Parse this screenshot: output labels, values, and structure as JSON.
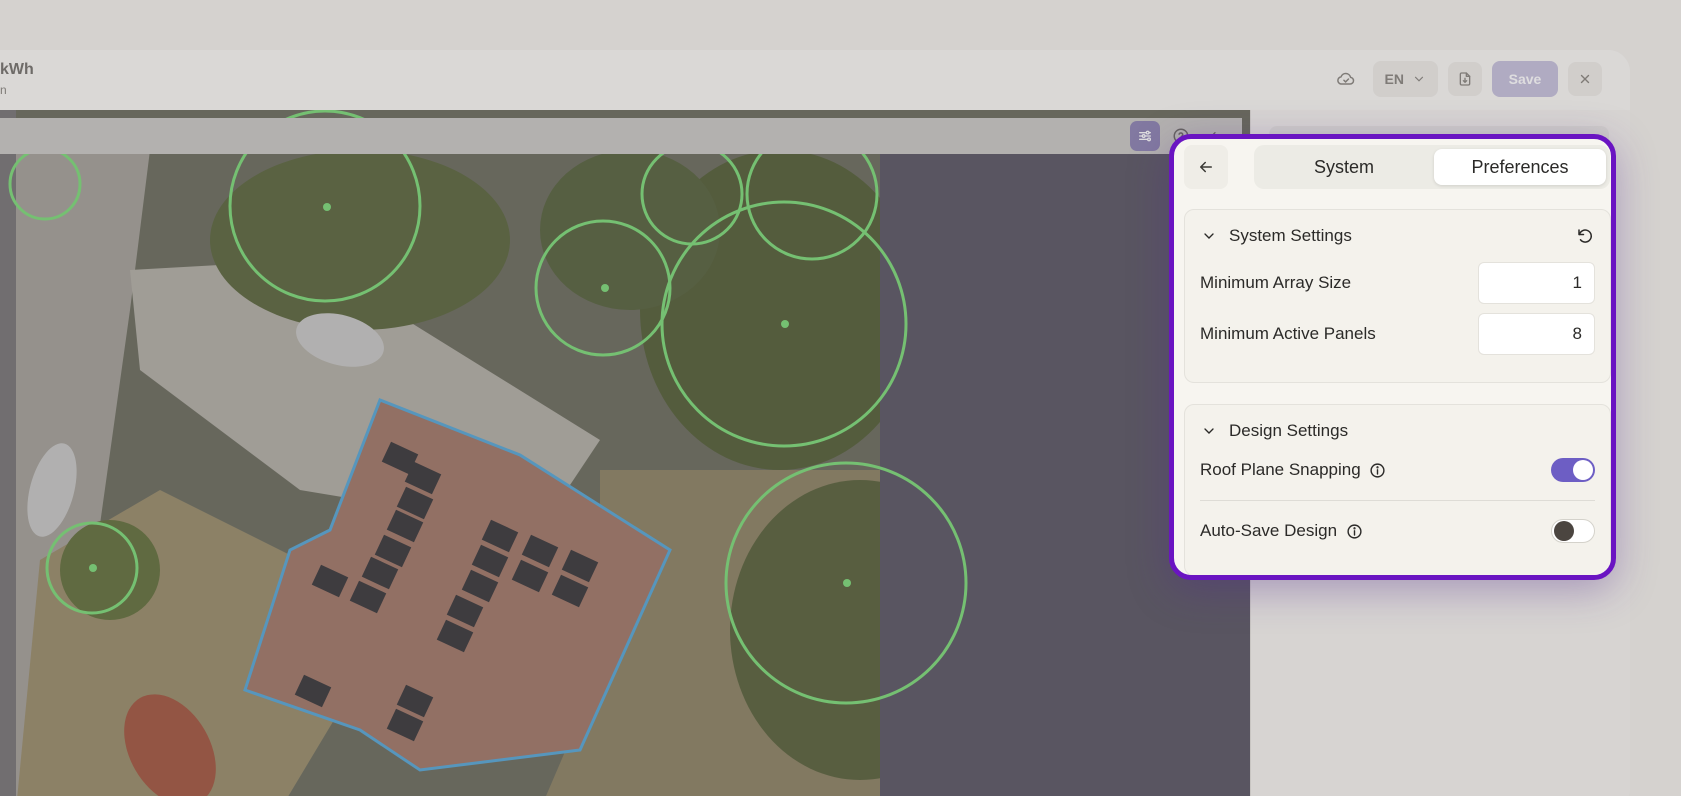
{
  "header": {
    "energy_text": "kWh",
    "sub_text": "n",
    "language": "EN",
    "save_label": "Save"
  },
  "colors": {
    "accent": "#6a14c2",
    "toggle_on": "#6d5ec4",
    "tree_ring": "#7fdc7a",
    "roof_outline": "#5aa9d6"
  },
  "popover": {
    "tabs": [
      {
        "label": "System",
        "active": false
      },
      {
        "label": "Preferences",
        "active": true
      }
    ],
    "system_settings": {
      "title": "System Settings",
      "fields": [
        {
          "label": "Minimum Array Size",
          "value": "1"
        },
        {
          "label": "Minimum Active Panels",
          "value": "8"
        }
      ]
    },
    "design_settings": {
      "title": "Design Settings",
      "toggles": [
        {
          "label": "Roof Plane Snapping",
          "on": true
        },
        {
          "label": "Auto-Save Design",
          "on": false
        }
      ]
    }
  },
  "icons": [
    "cloud-icon",
    "chevron-down-icon",
    "document-icon",
    "close-icon",
    "sliders-icon",
    "help-icon",
    "undo-icon",
    "arrow-left-icon",
    "reset-icon",
    "info-icon",
    "tree-icon"
  ]
}
